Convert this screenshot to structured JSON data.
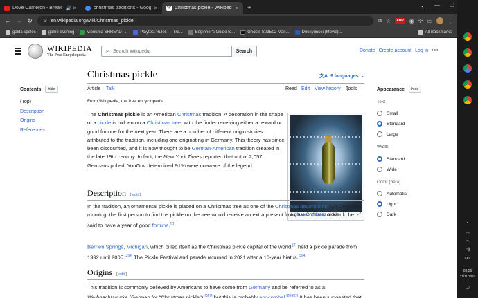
{
  "browser": {
    "tabs": [
      {
        "title": "Dove Cameron - Breakfast",
        "favicon_color": "#e62117",
        "close": "🔊 ✕"
      },
      {
        "title": "christmas traditions - Google S",
        "favicon_color": "#4285f4",
        "close": "✕"
      },
      {
        "title": "Christmas pickle - Wikipedia",
        "favicon_color": "#ffffff",
        "close": "✕"
      }
    ],
    "new_tab": "+",
    "url": "en.wikipedia.org/wiki/Christmas_pickle",
    "bookmarks": [
      {
        "label": "galda spēles",
        "kind": "folder"
      },
      {
        "label": "game evening",
        "kind": "folder"
      },
      {
        "label": "Vienuma SHREAD -...",
        "kind": "site",
        "color": "#2e9b3c"
      },
      {
        "label": "Playtest Rules — Tre...",
        "kind": "site",
        "color": "#4a6bd0"
      },
      {
        "label": "Beginner's Guide to...",
        "kind": "site",
        "color": "#3a3a3a"
      },
      {
        "label": "Ghosts S03E02 Man...",
        "kind": "site",
        "color": "#1a1a1a"
      },
      {
        "label": "Doukyuusei (Movie)...",
        "kind": "site",
        "color": "#2b5ea8"
      }
    ],
    "all_bookmarks": "All Bookmarks",
    "adblock_badge": "ABP"
  },
  "taskbar": {
    "lang": "LAV",
    "time": "03:56",
    "date": "21/11/2024"
  },
  "wiki_header": {
    "wordmark": "WIKIPEDIA",
    "tagline": "The Free Encyclopedia",
    "search_placeholder": "Search Wikipedia",
    "search_button": "Search",
    "links": [
      "Donate",
      "Create account",
      "Log in"
    ],
    "more": "•••"
  },
  "toc": {
    "title": "Contents",
    "hide": "hide",
    "items": [
      "(Top)",
      "Description",
      "Origins",
      "References"
    ]
  },
  "article": {
    "title": "Christmas pickle",
    "languages": "9 languages",
    "tabs": {
      "article": "Article",
      "talk": "Talk",
      "read": "Read",
      "edit": "Edit",
      "history": "View history",
      "tools": "Tools"
    },
    "from": "From Wikipedia, the free encyclopedia",
    "headings": {
      "description": "Description",
      "origins": "Origins",
      "edit": "edit"
    },
    "image_caption": "A glass Christmas pickle",
    "image_expand": "⤢"
  },
  "appearance": {
    "title": "Appearance",
    "hide": "hide",
    "text_label": "Text",
    "text_options": [
      "Small",
      "Standard",
      "Large"
    ],
    "text_selected": "Standard",
    "width_label": "Width",
    "width_options": [
      "Standard",
      "Wide"
    ],
    "width_selected": "Standard",
    "color_label": "Color (beta)",
    "color_options": [
      "Automatic",
      "Light",
      "Dark"
    ],
    "color_selected": "Light"
  }
}
